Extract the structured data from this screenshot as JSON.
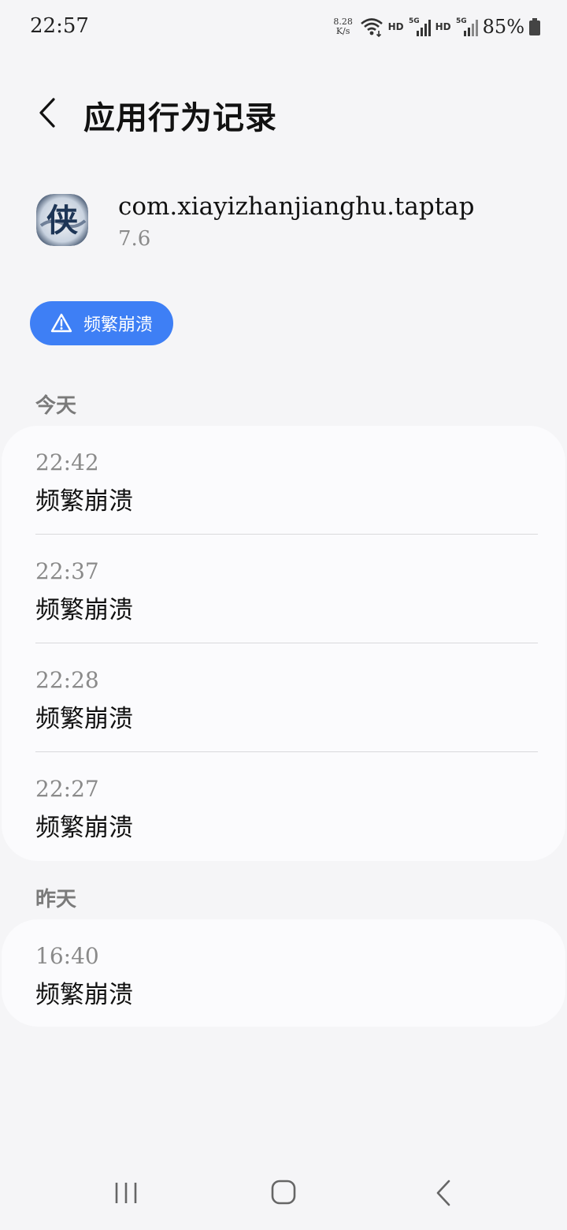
{
  "status_bar": {
    "time": "22:57",
    "net_speed_value": "8.28",
    "net_speed_unit": "K/s",
    "hd_label": "HD",
    "network_5g": "5G",
    "battery": "85%"
  },
  "header": {
    "title": "应用行为记录"
  },
  "app": {
    "package_name": "com.xiayizhanjianghu.taptap",
    "version": "7.6",
    "icon_glyph": "侠"
  },
  "filter_chip": {
    "label": "频繁崩溃"
  },
  "sections": [
    {
      "label": "今天",
      "records": [
        {
          "time": "22:42",
          "event": "频繁崩溃"
        },
        {
          "time": "22:37",
          "event": "频繁崩溃"
        },
        {
          "time": "22:28",
          "event": "频繁崩溃"
        },
        {
          "time": "22:27",
          "event": "频繁崩溃"
        }
      ]
    },
    {
      "label": "昨天",
      "records": [
        {
          "time": "16:40",
          "event": "频繁崩溃"
        }
      ]
    }
  ],
  "colors": {
    "accent": "#3e7ff5",
    "background": "#f5f5f7",
    "card": "#fbfbfd"
  }
}
